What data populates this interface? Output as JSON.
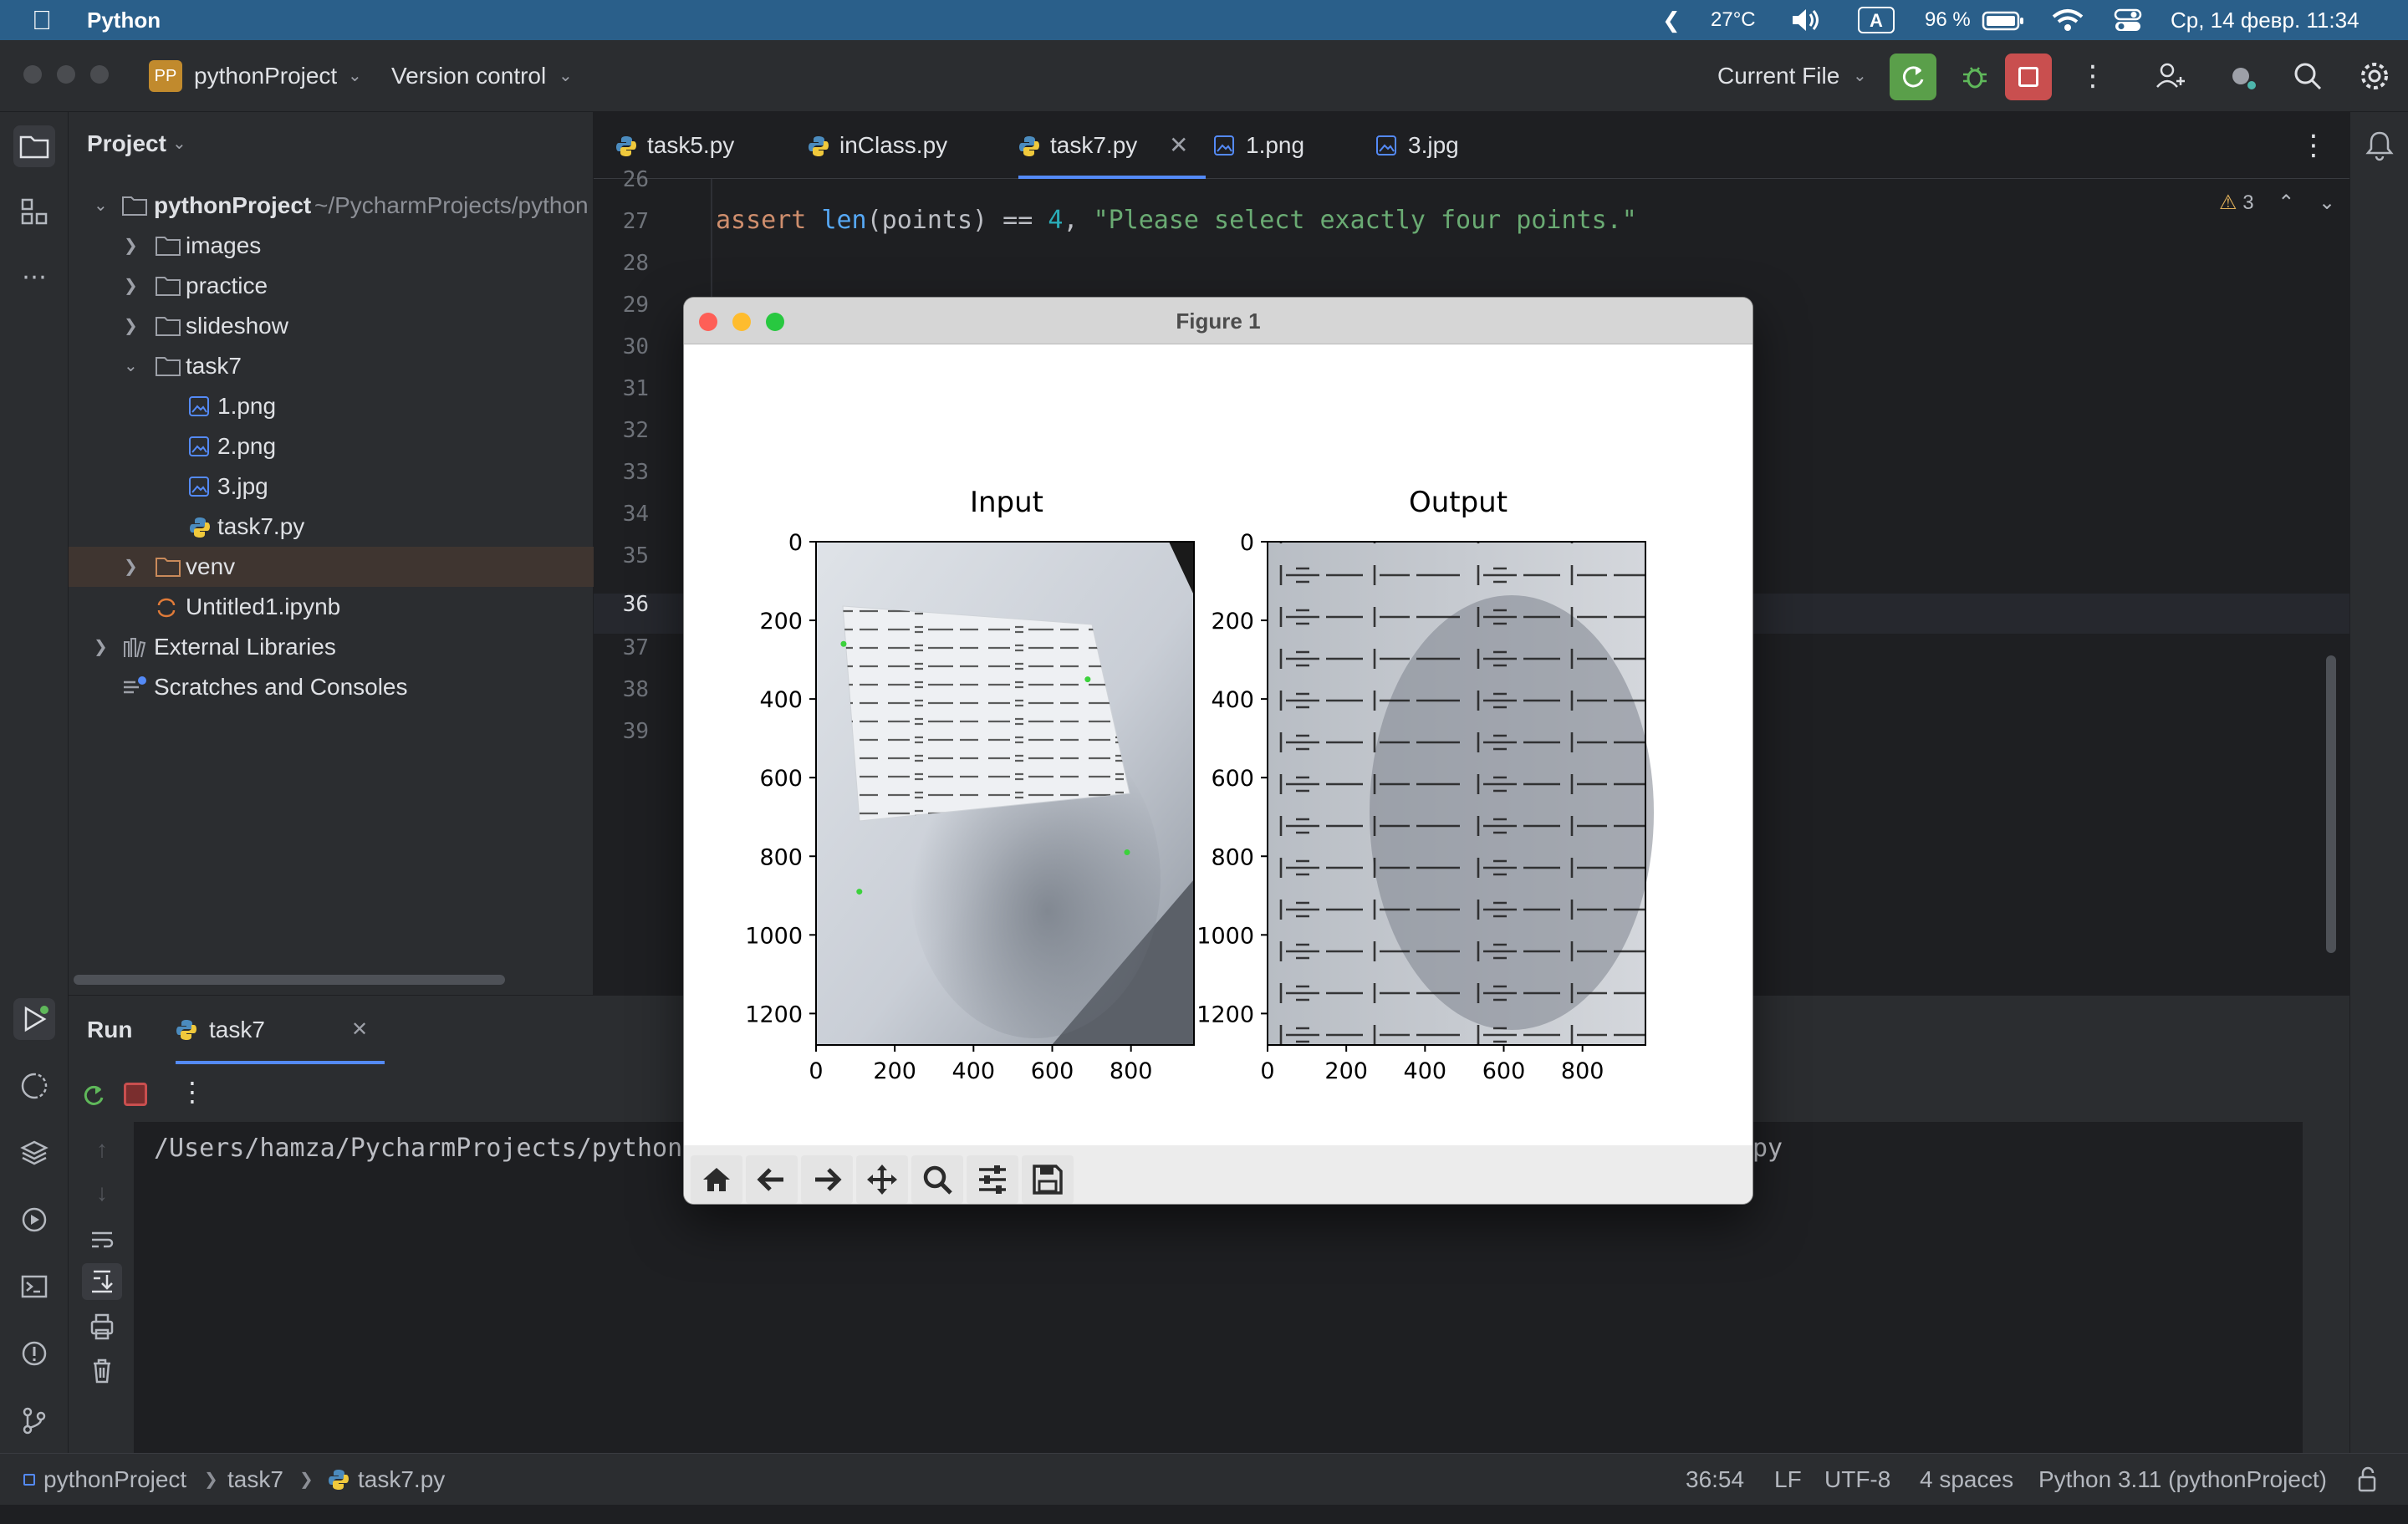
{
  "menubar": {
    "app_name": "Python",
    "temperature": "27°C",
    "input_source": "A",
    "battery": "96 %",
    "datetime": "Ср, 14 февр. 11:34"
  },
  "titlebar": {
    "project_badge": "PP",
    "project_name": "pythonProject",
    "vcs": "Version control",
    "run_config": "Current File"
  },
  "project_panel": {
    "title": "Project",
    "root_name": "pythonProject",
    "root_path": "~/PycharmProjects/python",
    "items": [
      {
        "label": "images"
      },
      {
        "label": "practice"
      },
      {
        "label": "slideshow"
      },
      {
        "label": "task7"
      },
      {
        "label": "1.png"
      },
      {
        "label": "2.png"
      },
      {
        "label": "3.jpg"
      },
      {
        "label": "task7.py"
      },
      {
        "label": "venv"
      },
      {
        "label": "Untitled1.ipynb"
      },
      {
        "label": "External Libraries"
      },
      {
        "label": "Scratches and Consoles"
      }
    ]
  },
  "tabs": [
    {
      "label": "task5.py"
    },
    {
      "label": "inClass.py"
    },
    {
      "label": "task7.py"
    },
    {
      "label": "1.png"
    },
    {
      "label": "3.jpg"
    }
  ],
  "editor": {
    "warnings_count": "3",
    "line_numbers": [
      "26",
      "27",
      "28",
      "29",
      "30",
      "31",
      "32",
      "33",
      "34",
      "35",
      "36",
      "37",
      "38",
      "39"
    ],
    "code_line_27": {
      "kw": "assert",
      "fn": "len",
      "args": "(points) == ",
      "num": "4",
      "comma": ", ",
      "str": "\"Please select exactly four points.\""
    }
  },
  "run_panel": {
    "title": "Run",
    "tab_label": "task7",
    "console_line_left": "/Users/hamza/PycharmProjects/pythonPro",
    "console_line_right": "py"
  },
  "figure": {
    "window_title": "Figure 1",
    "colors": {
      "marker": "#3cd23c",
      "frame": "#000000"
    }
  },
  "chart_data": [
    {
      "type": "image",
      "title": "Input",
      "xlim": [
        0,
        960
      ],
      "ylim": [
        1280,
        0
      ],
      "xticks": [
        0,
        200,
        400,
        600,
        800
      ],
      "yticks": [
        0,
        200,
        400,
        600,
        800,
        1000,
        1200
      ],
      "selected_points": [
        [
          70,
          260
        ],
        [
          690,
          350
        ],
        [
          790,
          790
        ],
        [
          110,
          890
        ]
      ]
    },
    {
      "type": "image",
      "title": "Output",
      "xlim": [
        0,
        960
      ],
      "ylim": [
        1280,
        0
      ],
      "xticks": [
        0,
        200,
        400,
        600,
        800
      ],
      "yticks": [
        0,
        200,
        400,
        600,
        800,
        1000,
        1200
      ]
    }
  ],
  "statusbar": {
    "breadcrumb": [
      "pythonProject",
      "task7",
      "task7.py"
    ],
    "position": "36:54",
    "line_sep": "LF",
    "encoding": "UTF-8",
    "indent": "4 spaces",
    "interpreter": "Python 3.11 (pythonProject)"
  }
}
